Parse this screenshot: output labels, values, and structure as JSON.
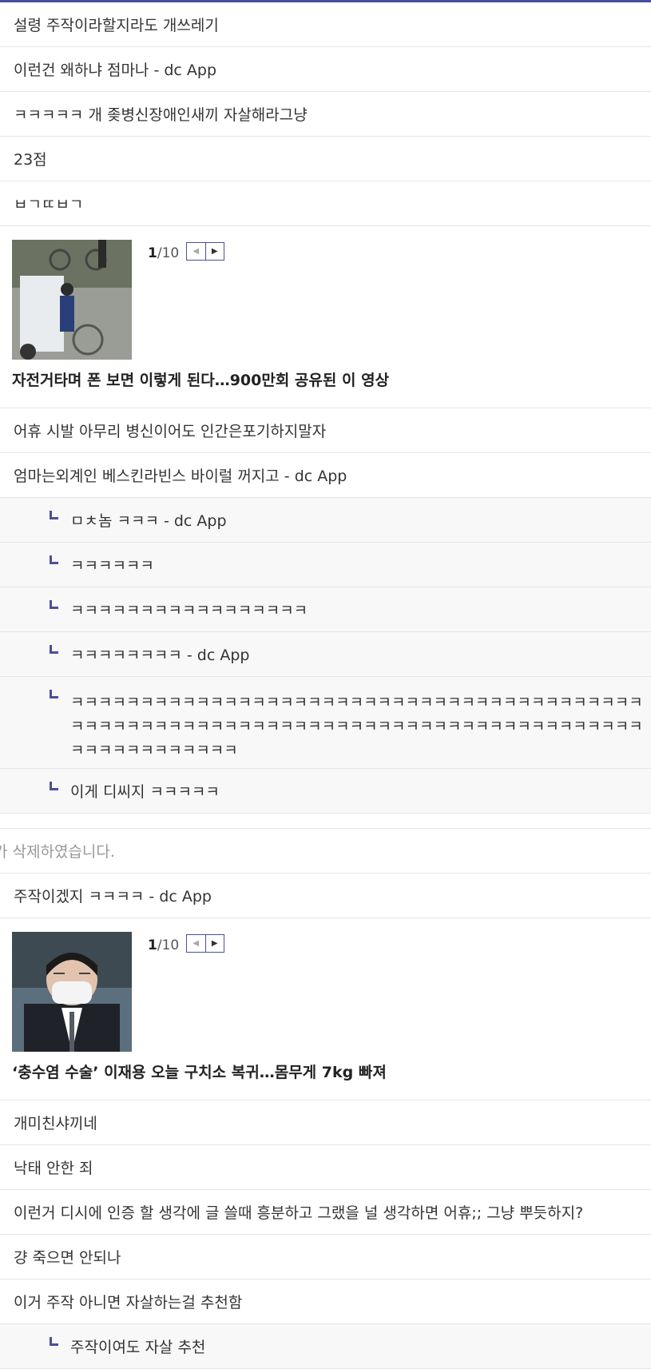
{
  "comments_top": [
    "설령 주작이라할지라도 개쓰레기",
    "이런건 왜하냐 점마나 - dc App",
    "ㅋㅋㅋㅋㅋ 개 좆병신장애인새끼 자살해라그냥",
    "23점",
    "ㅂㄱㄸㅂㄱ"
  ],
  "news1": {
    "page_current": "1",
    "page_total": "/10",
    "headline": "자전거타며 폰 보면 이렇게 된다…900만회 공유된 이 영상"
  },
  "comments_mid": [
    "어휴 시발 아무리 병신이어도 인간은포기하지말자",
    "엄마는외계인 베스킨라빈스 바이럴 꺼지고 - dc App"
  ],
  "replies_mid": [
    "ㅁㅊ놈 ㅋㅋㅋ - dc App",
    "ㅋㅋㅋㅋㅋㅋ",
    "ㅋㅋㅋㅋㅋㅋㅋㅋㅋㅋㅋㅋㅋㅋㅋㅋㅋ",
    "ㅋㅋㅋㅋㅋㅋㅋㅋ - dc App",
    "ㅋㅋㅋㅋㅋㅋㅋㅋㅋㅋㅋㅋㅋㅋㅋㅋㅋㅋㅋㅋㅋㅋㅋㅋㅋㅋㅋㅋㅋㅋㅋㅋㅋㅋㅋㅋㅋㅋㅋㅋㅋㅋㅋㅋㅋㅋㅋㅋㅋㅋㅋㅋㅋㅋㅋㅋㅋㅋㅋㅋㅋㅋㅋㅋㅋㅋㅋㅋㅋㅋㅋㅋㅋㅋㅋㅋㅋㅋㅋㅋㅋㅋㅋㅋㅋㅋㅋㅋㅋㅋㅋㅋㅋㅋ",
    "이게 디씨지 ㅋㅋㅋㅋㅋ"
  ],
  "deleted_notice": "가 삭제하였습니다.",
  "comment_after_delete": "주작이겠지 ㅋㅋㅋㅋ - dc App",
  "news2": {
    "page_current": "1",
    "page_total": "/10",
    "headline": "‘충수염 수술’ 이재용 오늘 구치소 복귀…몸무게 7kg 빠져"
  },
  "comments_bottom": [
    "개미친샤끼네",
    "낙태 안한 죄",
    "이런거 디시에 인증 할 생각에 글 쓸때 흥분하고 그랬을 널 생각하면 어휴;; 그냥 뿌듯하지?",
    "걍 죽으면 안되나",
    "이거 주작 아니면 자살하는걸 추천함"
  ],
  "reply_bottom": "주작이여도 자살 추천",
  "colors": {
    "accent": "#4a4f9c",
    "border": "#e5e5e5",
    "reply_bg": "#f8f8f8"
  }
}
